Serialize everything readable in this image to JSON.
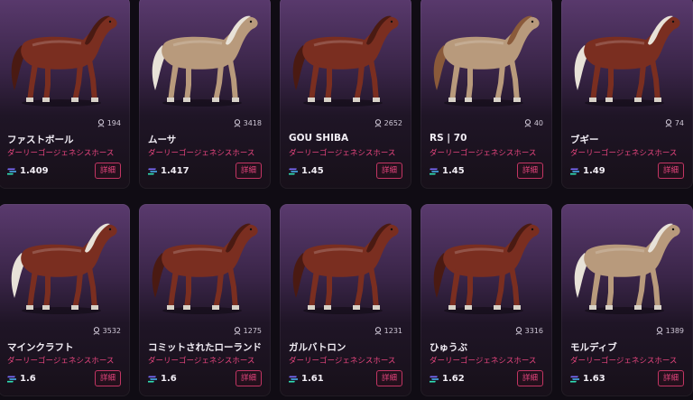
{
  "detail_label": "詳細",
  "horses": [
    {
      "name": "ファストボール",
      "breed": "ダーリーゴージェネシスホース",
      "likes": "194",
      "price": "1.409",
      "coat": "#7a2e20",
      "mane": "#4a1a12"
    },
    {
      "name": "ムーサ",
      "breed": "ダーリーゴージェネシスホース",
      "likes": "3418",
      "price": "1.417",
      "coat": "#b89a7c",
      "mane": "#e8e2d8"
    },
    {
      "name": "GOU SHIBA",
      "breed": "ダーリーゴージェネシスホース",
      "likes": "2652",
      "price": "1.45",
      "coat": "#7a2e20",
      "mane": "#4a1a12"
    },
    {
      "name": "RS | 70",
      "breed": "ダーリーゴージェネシスホース",
      "likes": "40",
      "price": "1.45",
      "coat": "#b89a7c",
      "mane": "#8a5a3a"
    },
    {
      "name": "ブギー",
      "breed": "ダーリーゴージェネシスホース",
      "likes": "74",
      "price": "1.49",
      "coat": "#7a2e20",
      "mane": "#e8e2d8"
    },
    {
      "name": "マインクラフト",
      "breed": "ダーリーゴージェネシスホース",
      "likes": "3532",
      "price": "1.6",
      "coat": "#7a2e20",
      "mane": "#e8e2d8"
    },
    {
      "name": "コミットされたローランド",
      "breed": "ダーリーゴージェネシスホース",
      "likes": "1275",
      "price": "1.6",
      "coat": "#7a2e20",
      "mane": "#4a1a12"
    },
    {
      "name": "ガルバトロン",
      "breed": "ダーリーゴージェネシスホース",
      "likes": "1231",
      "price": "1.61",
      "coat": "#7a2e20",
      "mane": "#4a1a12"
    },
    {
      "name": "ひゅうぶ",
      "breed": "ダーリーゴージェネシスホース",
      "likes": "3316",
      "price": "1.62",
      "coat": "#7a2e20",
      "mane": "#4a1a12"
    },
    {
      "name": "モルディブ",
      "breed": "ダーリーゴージェネシスホース",
      "likes": "1389",
      "price": "1.63",
      "coat": "#b89a7c",
      "mane": "#e8e2d8"
    }
  ]
}
